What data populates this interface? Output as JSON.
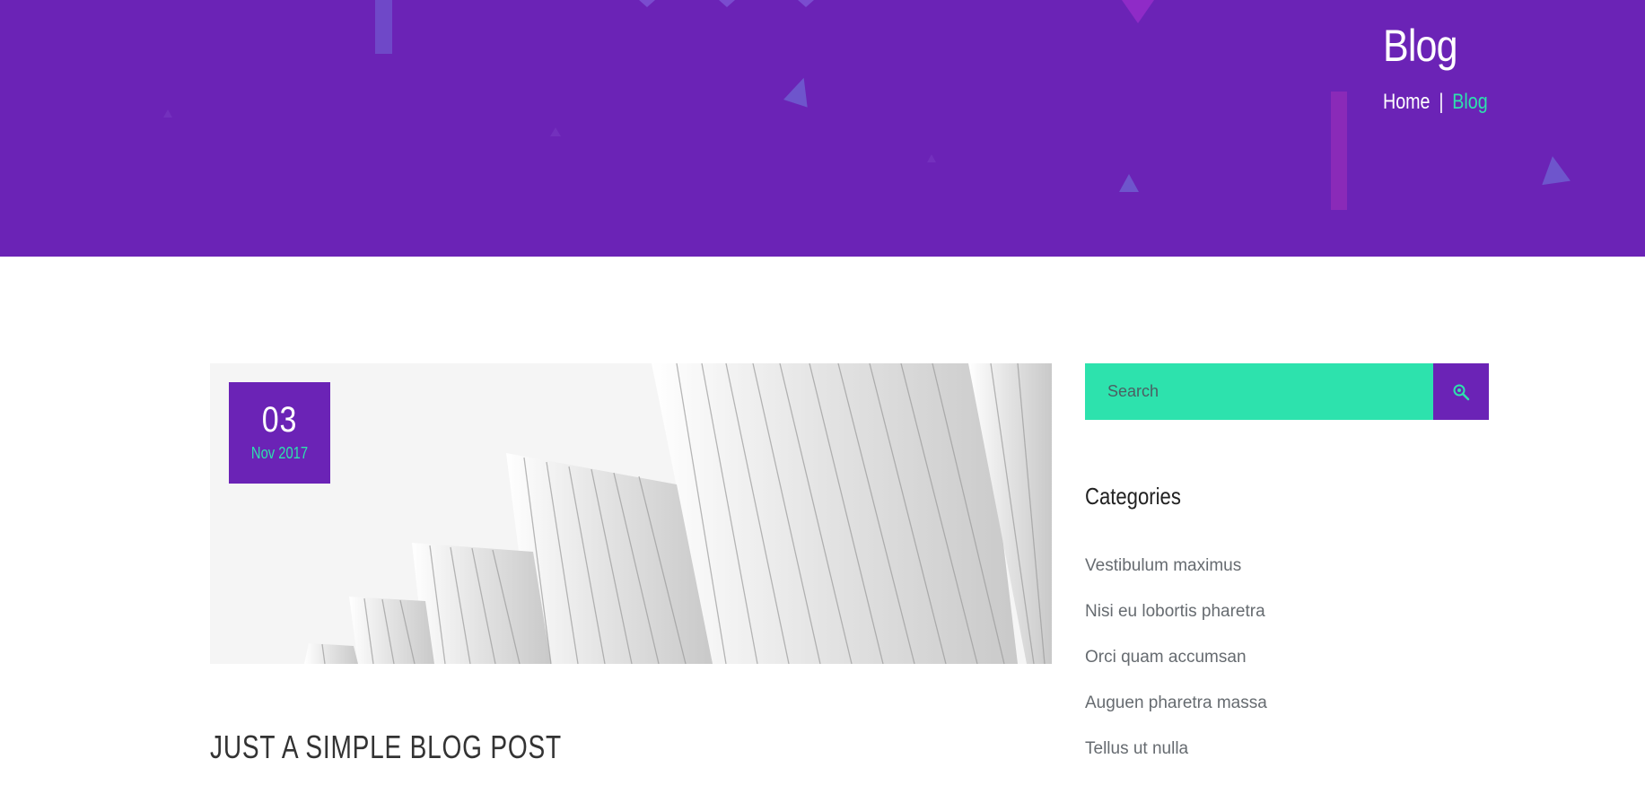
{
  "hero": {
    "title": "Blog",
    "breadcrumb": {
      "home": "Home",
      "separator": "|",
      "current": "Blog"
    }
  },
  "post": {
    "date_day": "03",
    "date_month": "Nov 2017",
    "title": "JUST A SIMPLE BLOG POST"
  },
  "sidebar": {
    "search": {
      "placeholder": "Search"
    },
    "categories_heading": "Categories",
    "categories": [
      "Vestibulum maximus",
      "Nisi eu lobortis pharetra",
      "Orci quam accumsan",
      "Auguen pharetra massa",
      "Tellus ut nulla"
    ]
  },
  "colors": {
    "primary": "#6b23b6",
    "accent": "#2de2ad",
    "text": "#333333"
  }
}
